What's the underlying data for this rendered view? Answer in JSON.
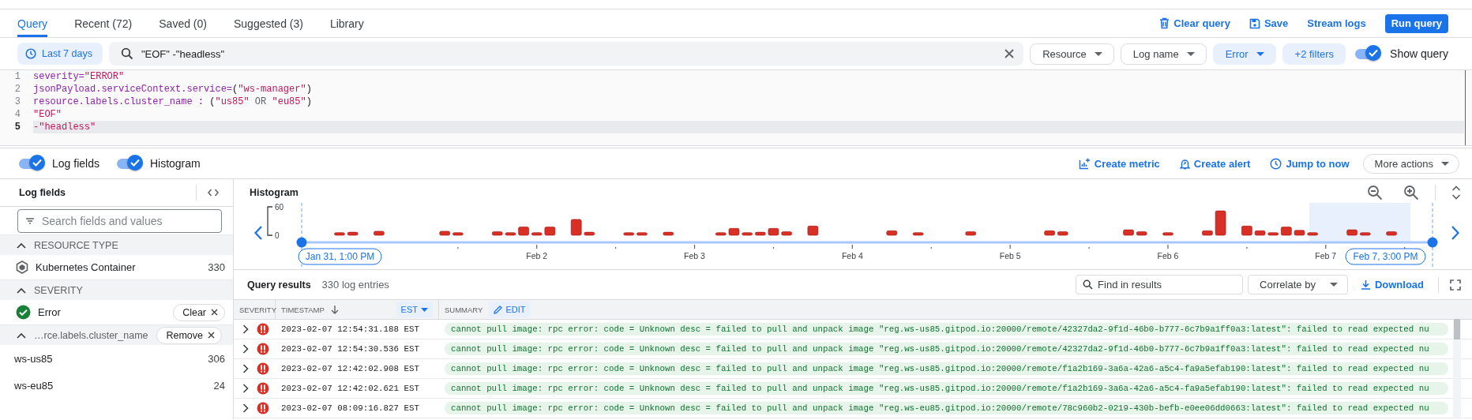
{
  "tabs": [
    {
      "label": "Query",
      "selected": true
    },
    {
      "label": "Recent (72)",
      "selected": false
    },
    {
      "label": "Saved (0)",
      "selected": false
    },
    {
      "label": "Suggested (3)",
      "selected": false
    },
    {
      "label": "Library",
      "selected": false
    }
  ],
  "header_actions": [
    {
      "label": "Clear query",
      "kind": "trash"
    },
    {
      "label": "Save",
      "kind": "save"
    },
    {
      "label": "Stream logs",
      "kind": "plain"
    },
    {
      "label": "Run query",
      "kind": "primary"
    }
  ],
  "time_range": {
    "label": "Last 7 days"
  },
  "search": {
    "value": "\"EOF\" -\"headless\""
  },
  "filters": [
    {
      "label": "Resource",
      "active": false,
      "dropdown": true
    },
    {
      "label": "Log name",
      "active": false,
      "dropdown": true
    },
    {
      "label": "Error",
      "active": true,
      "dropdown": true
    },
    {
      "label": "+2 filters",
      "active": true,
      "dropdown": false
    }
  ],
  "show_query": {
    "label": "Show query",
    "on": true
  },
  "editor": {
    "lines": [
      {
        "number": "1",
        "current": false,
        "tokens": [
          {
            "text": "severity=",
            "kind": "field"
          },
          {
            "text": "\"ERROR\"",
            "kind": "string"
          }
        ]
      },
      {
        "number": "2",
        "current": false,
        "tokens": [
          {
            "text": "jsonPayload.serviceContext.service=",
            "kind": "field"
          },
          {
            "text": "(",
            "kind": "punct"
          },
          {
            "text": "\"ws-manager\"",
            "kind": "string"
          },
          {
            "text": ")",
            "kind": "punct"
          }
        ]
      },
      {
        "number": "3",
        "current": false,
        "tokens": [
          {
            "text": "resource.labels.cluster_name : ",
            "kind": "field"
          },
          {
            "text": "(",
            "kind": "punct"
          },
          {
            "text": "\"us85\"",
            "kind": "string"
          },
          {
            "text": " OR ",
            "kind": "op"
          },
          {
            "text": "\"eu85\"",
            "kind": "string"
          },
          {
            "text": ")",
            "kind": "punct"
          }
        ]
      },
      {
        "number": "4",
        "current": false,
        "tokens": [
          {
            "text": "\"EOF\"",
            "kind": "string"
          }
        ]
      },
      {
        "number": "5",
        "current": true,
        "tokens": [
          {
            "text": "-\"headless\"",
            "kind": "string"
          }
        ]
      }
    ]
  },
  "view_toggles": [
    {
      "label": "Log fields",
      "on": true
    },
    {
      "label": "Histogram",
      "on": true
    }
  ],
  "panel_actions": [
    {
      "label": "Create metric",
      "kind": "metric"
    },
    {
      "label": "Create alert",
      "kind": "alert"
    },
    {
      "label": "Jump to now",
      "kind": "clock"
    },
    {
      "label": "More actions",
      "kind": "menu"
    }
  ],
  "log_fields": {
    "title": "Log fields",
    "search": {
      "placeholder": "Search fields and values"
    },
    "sections": [
      {
        "title": "RESOURCE TYPE",
        "expanded": true,
        "items": [
          {
            "label": "Kubernetes Container",
            "count": "330",
            "kind": "resource"
          }
        ]
      },
      {
        "title": "SEVERITY",
        "expanded": true,
        "items": [
          {
            "label": "Error",
            "kind": "severity",
            "action": "Clear"
          }
        ]
      },
      {
        "title": "…rce.labels.cluster_name",
        "expanded": true,
        "action": "Remove",
        "items": [
          {
            "label": "ws-us85",
            "count": "306",
            "kind": "value"
          },
          {
            "label": "ws-eu85",
            "count": "24",
            "kind": "value"
          }
        ]
      }
    ]
  },
  "histogram": {
    "title": "Histogram",
    "start_label": "Jan 31, 1:00 PM",
    "end_label": "Feb 7, 3:00 PM",
    "chart_data": {
      "type": "bar",
      "ylim": [
        0,
        60
      ],
      "yticks": [
        0,
        60
      ],
      "categories": [
        null,
        null,
        null,
        null,
        null,
        null,
        null,
        null,
        null,
        null,
        null,
        null,
        null,
        null,
        null,
        null,
        null,
        null,
        "Feb 2",
        null,
        null,
        null,
        null,
        null,
        null,
        null,
        null,
        null,
        null,
        null,
        "Feb 3",
        null,
        null,
        null,
        null,
        null,
        null,
        null,
        null,
        null,
        null,
        null,
        "Feb 4",
        null,
        null,
        null,
        null,
        null,
        null,
        null,
        null,
        null,
        null,
        null,
        "Feb 5",
        null,
        null,
        null,
        null,
        null,
        null,
        null,
        null,
        null,
        null,
        null,
        "Feb 6",
        null,
        null,
        null,
        null,
        null,
        null,
        null,
        null,
        null,
        null,
        null,
        "Feb 7",
        null,
        null,
        null,
        null,
        null,
        null,
        null
      ],
      "values": [
        0,
        0,
        0,
        3,
        4,
        0,
        6,
        0,
        0,
        0,
        0,
        6,
        3,
        0,
        0,
        5,
        3,
        15,
        3,
        15,
        0,
        31,
        4,
        0,
        0,
        3,
        3,
        0,
        4,
        0,
        0,
        0,
        3,
        12,
        3,
        4,
        12,
        5,
        0,
        17,
        0,
        0,
        0,
        0,
        0,
        7,
        0,
        3,
        0,
        0,
        0,
        5,
        0,
        0,
        0,
        0,
        0,
        7,
        5,
        0,
        0,
        0,
        0,
        9,
        5,
        0,
        3,
        0,
        0,
        7,
        49,
        0,
        17,
        7,
        3,
        15,
        8,
        3,
        0,
        0,
        9,
        3,
        0,
        5,
        0,
        0
      ]
    }
  },
  "results": {
    "title": "Query results",
    "count": "330 log entries",
    "find": {
      "placeholder": "Find in results"
    },
    "correlate": {
      "label": "Correlate by"
    },
    "download": {
      "label": "Download"
    },
    "columns": [
      {
        "label": "SEVERITY",
        "kind": "plain"
      },
      {
        "label": "TIMESTAMP",
        "kind": "timezone",
        "sort_descending": true,
        "chip": "EST"
      },
      {
        "label": "SUMMARY",
        "kind": "editable",
        "chip": "EDIT"
      }
    ],
    "rows": [
      {
        "kind": "error",
        "timestamp": "2023-02-07 12:54:31.188 EST",
        "summary": "cannot pull image: rpc error: code = Unknown desc = failed to pull and unpack image \"reg.ws-us85.gitpod.io:20000/remote/42327da2-9f1d-46b0-b777-6c7b9a1ff0a3:latest\": failed to read expected nu"
      },
      {
        "kind": "error",
        "timestamp": "2023-02-07 12:54:30.536 EST",
        "summary": "cannot pull image: rpc error: code = Unknown desc = failed to pull and unpack image \"reg.ws-us85.gitpod.io:20000/remote/42327da2-9f1d-46b0-b777-6c7b9a1ff0a3:latest\": failed to read expected nu"
      },
      {
        "kind": "error",
        "timestamp": "2023-02-07 12:42:02.908 EST",
        "summary": "cannot pull image: rpc error: code = Unknown desc = failed to pull and unpack image \"reg.ws-us85.gitpod.io:20000/remote/f1a2b169-3a6a-42a6-a5c4-fa9a5efab190:latest\": failed to read expected nu"
      },
      {
        "kind": "error",
        "timestamp": "2023-02-07 12:42:02.621 EST",
        "summary": "cannot pull image: rpc error: code = Unknown desc = failed to pull and unpack image \"reg.ws-us85.gitpod.io:20000/remote/f1a2b169-3a6a-42a6-a5c4-fa9a5efab190:latest\": failed to read expected nu"
      },
      {
        "kind": "error",
        "timestamp": "2023-02-07 08:09:16.827 EST",
        "summary": "cannot pull image: rpc error: code = Unknown desc = failed to pull and unpack image \"reg.ws-eu85.gitpod.io:20000/remote/78c960b2-0219-430b-befb-e0ee06dd0663:latest\": failed to read expected nu"
      }
    ]
  }
}
